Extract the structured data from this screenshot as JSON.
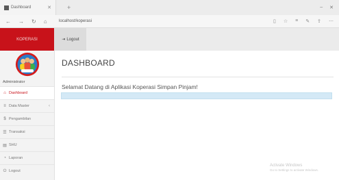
{
  "browser": {
    "tab_title": "Dashboard",
    "url": "localhost/koperasi"
  },
  "sidebar": {
    "brand": "KOPERASI",
    "role": "Administrator",
    "items": [
      {
        "label": "Dashboard",
        "icon": "home-icon"
      },
      {
        "label": "Data Master",
        "icon": "database-icon"
      },
      {
        "label": "Pengambilan",
        "icon": "money-icon"
      },
      {
        "label": "Transaksi",
        "icon": "list-icon"
      },
      {
        "label": "SHU",
        "icon": "chart-icon"
      },
      {
        "label": "Laporan",
        "icon": "report-icon"
      },
      {
        "label": "Logout",
        "icon": "power-icon"
      }
    ]
  },
  "topbar": {
    "logout_label": "Logout"
  },
  "main": {
    "title": "DASHBOARD",
    "welcome": "Selamat Datang di Aplikasi Koperasi Simpan Pinjam!"
  },
  "watermark": {
    "title": "Activate Windows",
    "subtitle": "Go to Settings to activate Windows."
  },
  "colors": {
    "brand_red": "#c8121a",
    "alert_blue": "#d4e9f6"
  }
}
